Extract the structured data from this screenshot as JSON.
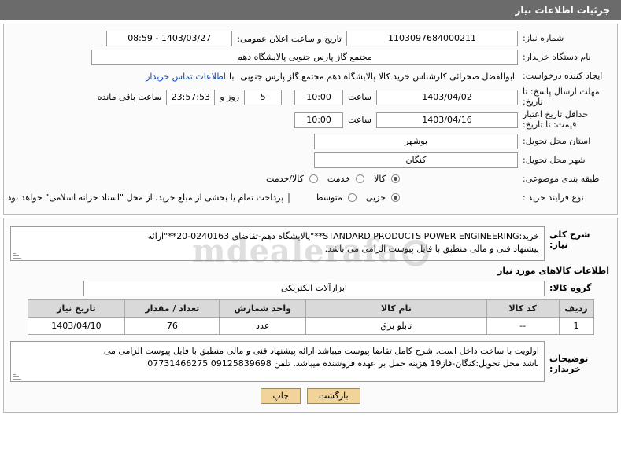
{
  "header": {
    "title": "جزئیات اطلاعات نیاز"
  },
  "form": {
    "need_number_label": "شماره نیاز:",
    "need_number_value": "1103097684000211",
    "public_announce_label": "تاریخ و ساعت اعلان عمومی:",
    "public_announce_value": "1403/03/27 - 08:59",
    "buyer_org_label": "نام دستگاه خریدار:",
    "buyer_org_value": "مجتمع گاز پارس جنوبی  پالایشگاه دهم",
    "requester_label": "ایجاد کننده درخواست:",
    "requester_value": "ابوالفضل صحرائی کارشناس خرید کالا پالایشگاه دهم مجتمع گاز پارس جنوبی",
    "contact_link": "اطلاعات تماس خریدار",
    "contact_with_label": "با",
    "deadline_label": "مهلت ارسال پاسخ: تا تاریخ:",
    "deadline_date": "1403/04/02",
    "deadline_hour_label": "ساعت",
    "deadline_hour": "10:00",
    "remaining_days": "5",
    "remaining_days_label": "روز و",
    "remaining_time": "23:57:53",
    "remaining_suffix": "ساعت باقی مانده",
    "price_validity_label": "حداقل تاریخ اعتبار قیمت: تا تاریخ:",
    "price_validity_date": "1403/04/16",
    "price_validity_hour_label": "ساعت",
    "price_validity_hour": "10:00",
    "province_label": "استان محل تحویل:",
    "province_value": "بوشهر",
    "city_label": "شهر محل تحویل:",
    "city_value": "کنگان",
    "category_label": "طبقه بندی موضوعی:",
    "category_options": [
      {
        "label": "کالا",
        "checked": true
      },
      {
        "label": "خدمت",
        "checked": false
      },
      {
        "label": "کالا/خدمت",
        "checked": false
      }
    ],
    "process_label": "نوع فرآیند خرید :",
    "process_options": [
      {
        "label": "جزیی",
        "checked": true
      },
      {
        "label": "متوسط",
        "checked": false
      }
    ],
    "payment_checkbox_text": "پرداخت تمام یا بخشی از مبلغ خرید، از محل \"اسناد خزانه اسلامی\" خواهد بود."
  },
  "description": {
    "label": "شرح کلی نیاز:",
    "lines": [
      "خرید:STANDARD PRODUCTS POWER ENGINEERING**\"پالایشگاه دهم-تقاضای 0240163-20**\"ارائه",
      "پیشنهاد فنی و مالی منطبق با فایل پیوست الزامی می باشد."
    ]
  },
  "goods_section": {
    "title": "اطلاعات کالاهای مورد نیاز",
    "group_label": "گروه کالا:",
    "group_value": "ابزارآلات الکتریکی"
  },
  "table": {
    "headers": [
      "ردیف",
      "کد کالا",
      "نام کالا",
      "واحد شمارش",
      "تعداد / مقدار",
      "تاریخ نیاز"
    ],
    "rows": [
      {
        "row": "1",
        "code": "--",
        "name": "تابلو برق",
        "unit": "عدد",
        "qty": "76",
        "date": "1403/04/10"
      }
    ]
  },
  "buyer_notes": {
    "label": "توضیحات خریدار:",
    "lines": [
      "اولویت با ساخت داخل است. شرح کامل تقاضا پیوست میباشد ارائه پیشنهاد فنی و مالی منطبق با فایل پیوست الزامی می",
      "باشد        محل تحویل:کنگان-فاز19 هزینه حمل بر عهده فروشنده میباشد. تلفن 09125839698  07731466275"
    ]
  },
  "footer": {
    "back_button": "بازگشت",
    "print_button": "چاپ"
  },
  "watermark": {
    "text": "mdealerafa"
  }
}
